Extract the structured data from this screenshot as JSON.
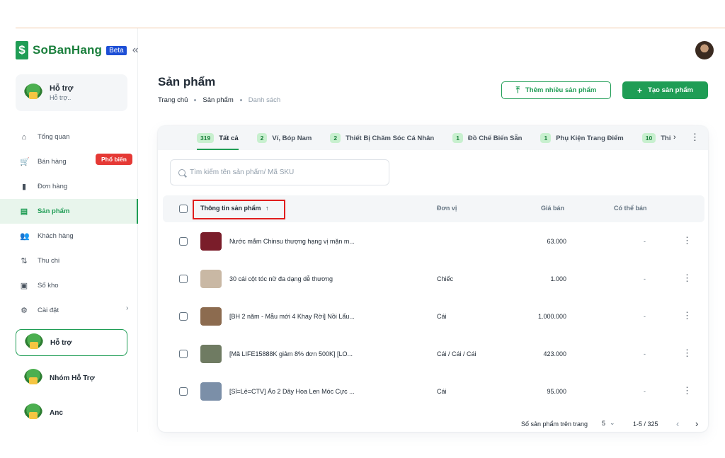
{
  "brand": {
    "name": "SoBanHang",
    "badge_symbol": "$",
    "beta": "Beta",
    "collapse_icon": "«"
  },
  "support_card": {
    "title": "Hỗ trợ",
    "subtitle": "Hỗ trợ.."
  },
  "nav": [
    {
      "label": "Tổng quan",
      "icon": "⌂"
    },
    {
      "label": "Bán hàng",
      "icon": "🛒"
    },
    {
      "label": "Đơn hàng",
      "icon": "▮"
    },
    {
      "label": "Sản phẩm",
      "icon": "▤"
    },
    {
      "label": "Khách hàng",
      "icon": "👥"
    },
    {
      "label": "Thu chi",
      "icon": "⇅"
    },
    {
      "label": "Sổ kho",
      "icon": "▣"
    },
    {
      "label": "Cài đặt",
      "icon": "⚙"
    }
  ],
  "nav_badge": "Phổ biến",
  "nav_chevron": "›",
  "workspaces": [
    {
      "name": "Hỗ trợ"
    },
    {
      "name": "Nhóm Hỗ Trợ"
    },
    {
      "name": "Anc"
    }
  ],
  "page": {
    "title": "Sản phẩm",
    "breadcrumb": [
      "Trang chủ",
      "Sản phẩm",
      "Danh sách"
    ]
  },
  "actions": {
    "bulk_add": "Thêm nhiều sản phẩm",
    "bulk_icon": "⤒",
    "create": "Tạo sản phẩm",
    "create_icon": "+"
  },
  "tabs": [
    {
      "count": "319",
      "label": "Tất cả"
    },
    {
      "count": "2",
      "label": "Ví, Bóp Nam"
    },
    {
      "count": "2",
      "label": "Thiết Bị Chăm Sóc Cá Nhân"
    },
    {
      "count": "1",
      "label": "Đồ Chế Biến Sẵn"
    },
    {
      "count": "1",
      "label": "Phụ Kiện Trang Điểm"
    },
    {
      "count": "10",
      "label": "Thi"
    }
  ],
  "tabs_next": "›",
  "tabs_more": "⋮",
  "search": {
    "placeholder": "Tìm kiếm tên sản phẩm/ Mã SKU"
  },
  "table": {
    "columns": {
      "info": "Thông tin sản phẩm",
      "sort_icon": "↑",
      "unit": "Đơn vị",
      "price": "Giá bán",
      "available": "Có thể bán"
    },
    "rows": [
      {
        "name": "Nước mắm Chinsu thượng hạng vị mặn m...",
        "unit": "",
        "price": "63.000",
        "available": "-",
        "thumb_color": "#7a1d2a"
      },
      {
        "name": "30 cái cột tóc nữ đa dạng dễ thương",
        "unit": "Chiếc",
        "price": "1.000",
        "available": "-",
        "thumb_color": "#c9b8a4"
      },
      {
        "name": "[BH 2 năm - Mẫu mới 4 Khay Rời] Nồi Lẩu...",
        "unit": "Cái",
        "price": "1.000.000",
        "available": "-",
        "thumb_color": "#8c6b4f"
      },
      {
        "name": "[Mã LIFE15888K giảm 8% đơn 500K] [LO...",
        "unit": "Cái / Cái / Cái",
        "price": "423.000",
        "available": "-",
        "thumb_color": "#6f7b62"
      },
      {
        "name": "[Sỉ=Lẻ=CTV] Áo 2 Dây Hoa Len Móc Cực ...",
        "unit": "Cái",
        "price": "95.000",
        "available": "-",
        "thumb_color": "#7b8fa8"
      }
    ],
    "row_menu_icon": "⋮"
  },
  "pagination": {
    "rows_per_page_label": "Số sản phẩm trên trang",
    "rows_per_page": "5",
    "dropdown_icon": "⌄",
    "range": "1-5 / 325",
    "prev_icon": "‹",
    "next_icon": "›"
  }
}
